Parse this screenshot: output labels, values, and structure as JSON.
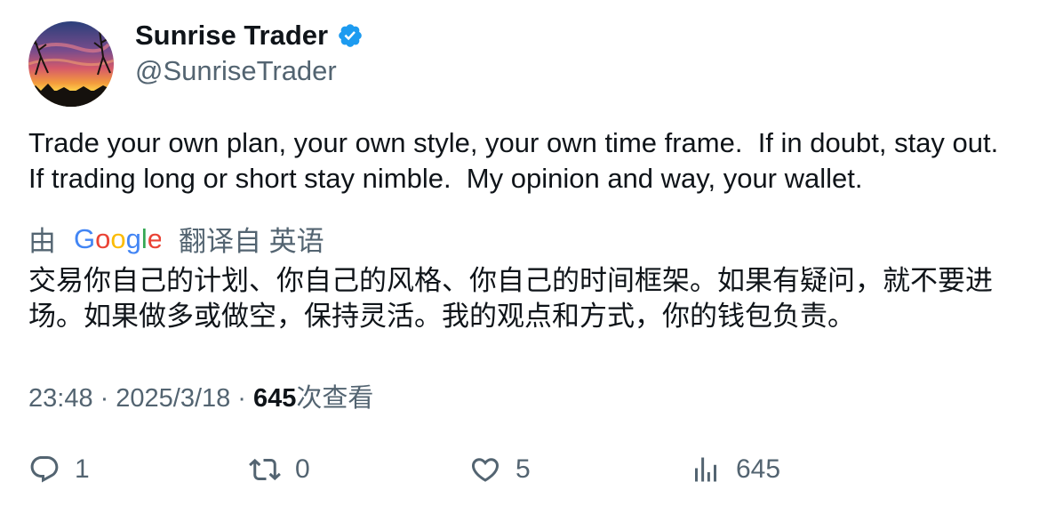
{
  "author": {
    "display_name": "Sunrise Trader",
    "handle": "@SunriseTrader",
    "verified": true,
    "avatar": "sunset-landscape"
  },
  "tweet": {
    "text": "Trade your own plan, your own style, your own time frame.  If in doubt, stay out.\nIf trading long or short stay nimble.  My opinion and way, your wallet."
  },
  "translation": {
    "prefix": "由",
    "provider": "Google",
    "suffix": "翻译自 英语",
    "text": "交易你自己的计划、你自己的风格、你自己的时间框架。如果有疑问，就不要进场。如果做多或做空，保持灵活。我的观点和方式，你的钱包负责。"
  },
  "meta": {
    "time": "23:48",
    "separator": "·",
    "date": "2025/3/18",
    "views": "645",
    "views_label": "次查看"
  },
  "actions": {
    "replies": "1",
    "reposts": "0",
    "likes": "5",
    "views": "645"
  },
  "colors": {
    "text_primary": "#0f1419",
    "text_secondary": "#536471",
    "verified_blue": "#1d9bf0"
  }
}
